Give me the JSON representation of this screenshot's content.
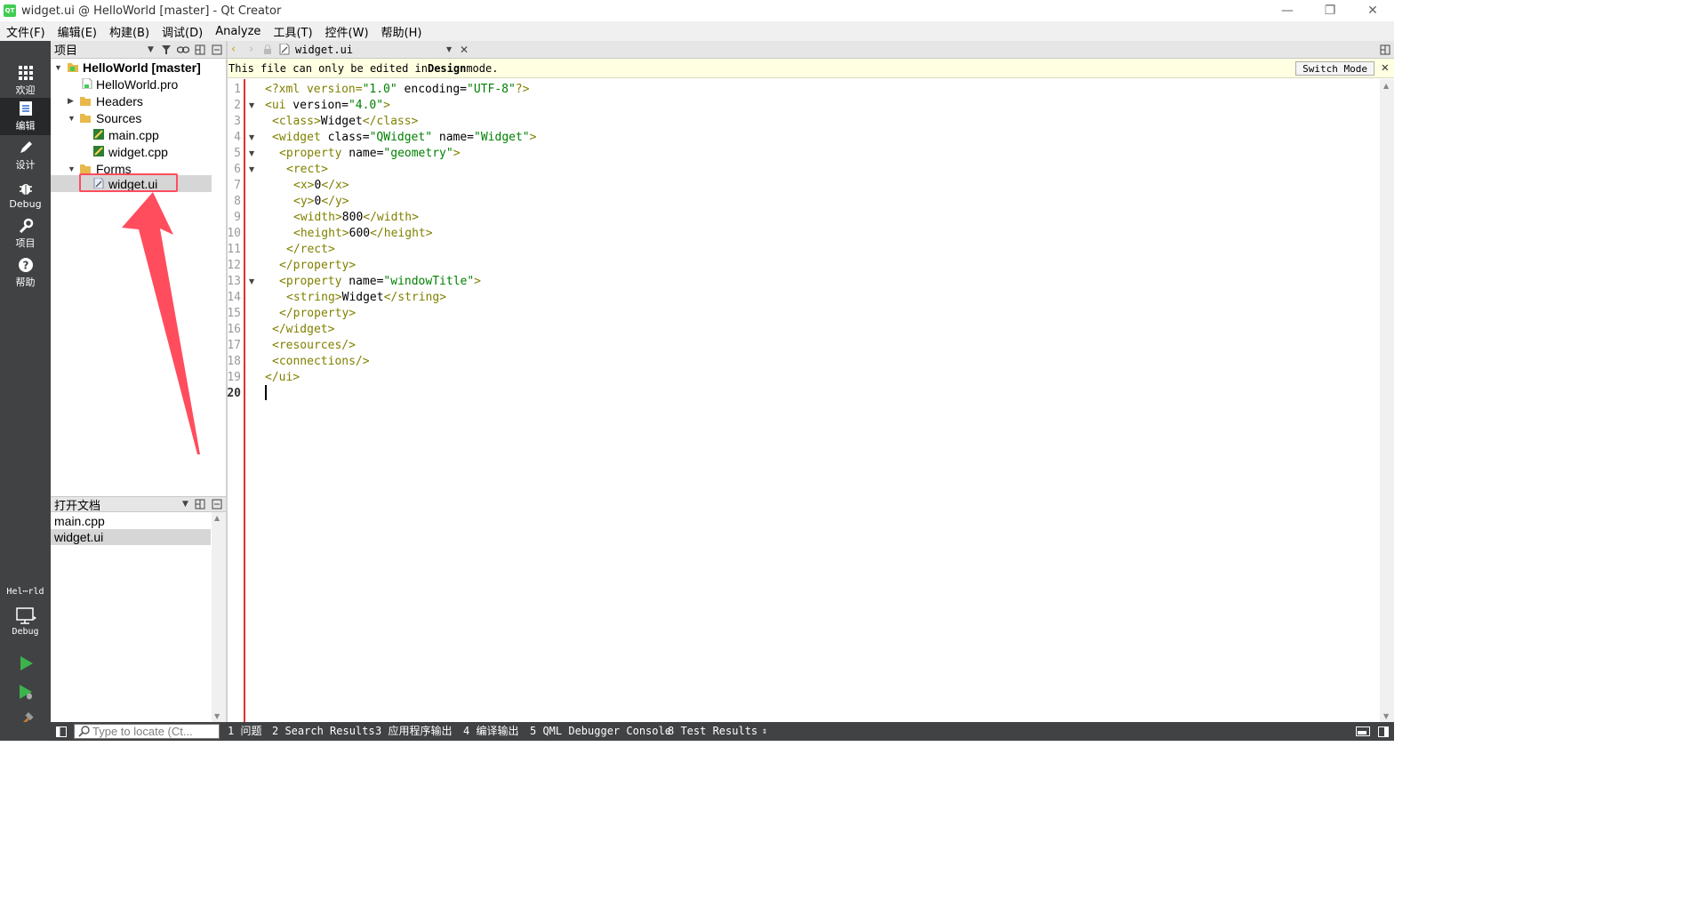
{
  "window": {
    "title": "widget.ui @ HelloWorld [master] - Qt Creator",
    "logo_text": "QT",
    "minimize": "—",
    "restore": "❐",
    "close": "✕"
  },
  "menu": [
    "文件(F)",
    "编辑(E)",
    "构建(B)",
    "调试(D)",
    "Analyze",
    "工具(T)",
    "控件(W)",
    "帮助(H)"
  ],
  "modes": [
    {
      "label": "欢迎",
      "icon": "grid-icon"
    },
    {
      "label": "编辑",
      "icon": "edit-doc-icon",
      "active": true
    },
    {
      "label": "设计",
      "icon": "pen-icon"
    },
    {
      "label": "Debug",
      "icon": "bug-icon"
    },
    {
      "label": "项目",
      "icon": "wrench-icon"
    },
    {
      "label": "帮助",
      "icon": "help-icon"
    }
  ],
  "kit": {
    "project": "Hel⋯rld",
    "config": "Debug"
  },
  "project_pane": {
    "title": "项目",
    "tree": [
      {
        "label": "HelloWorld [master]",
        "bold": true
      },
      {
        "label": "HelloWorld.pro"
      },
      {
        "label": "Headers"
      },
      {
        "label": "Sources"
      },
      {
        "label": "main.cpp"
      },
      {
        "label": "widget.cpp"
      },
      {
        "label": "Forms"
      },
      {
        "label": "widget.ui",
        "selected": true
      }
    ]
  },
  "open_docs": {
    "title": "打开文档",
    "items": [
      "main.cpp",
      "widget.ui"
    ]
  },
  "editor_toolbar": {
    "file": "widget.ui"
  },
  "infobar": {
    "prefix": "This file can only be edited in ",
    "bold": "Design",
    "suffix": " mode.",
    "button": "Switch Mode",
    "close": "✕"
  },
  "editor": {
    "current_line": 20,
    "lines": [
      "1",
      "2",
      "3",
      "4",
      "5",
      "6",
      "7",
      "8",
      "9",
      "10",
      "11",
      "12",
      "13",
      "14",
      "15",
      "16",
      "17",
      "18",
      "19",
      "20"
    ],
    "code": {
      "l1": {
        "a": "<?xml version=",
        "b": "\"1.0\"",
        "c": " encoding=",
        "d": "\"UTF-8\"",
        "e": "?>"
      },
      "l2": {
        "a": "<ui",
        "b": " version=",
        "c": "\"4.0\"",
        "d": ">"
      },
      "l3": {
        "a": "<class>",
        "b": "Widget",
        "c": "</class>"
      },
      "l4": {
        "a": "<widget",
        "b": " class=",
        "c": "\"QWidget\"",
        "d": " name=",
        "e": "\"Widget\"",
        "f": ">"
      },
      "l5": {
        "a": "<property",
        "b": " name=",
        "c": "\"geometry\"",
        "d": ">"
      },
      "l6": {
        "a": "<rect>"
      },
      "l7": {
        "a": "<x>",
        "b": "0",
        "c": "</x>"
      },
      "l8": {
        "a": "<y>",
        "b": "0",
        "c": "</y>"
      },
      "l9": {
        "a": "<width>",
        "b": "800",
        "c": "</width>"
      },
      "l10": {
        "a": "<height>",
        "b": "600",
        "c": "</height>"
      },
      "l11": {
        "a": "</rect>"
      },
      "l12": {
        "a": "</property>"
      },
      "l13": {
        "a": "<property",
        "b": " name=",
        "c": "\"windowTitle\"",
        "d": ">"
      },
      "l14": {
        "a": "<string>",
        "b": "Widget",
        "c": "</string>"
      },
      "l15": {
        "a": "</property>"
      },
      "l16": {
        "a": "</widget>"
      },
      "l17": {
        "a": "<resources/>"
      },
      "l18": {
        "a": "<connections/>"
      },
      "l19": {
        "a": "</ui>"
      }
    }
  },
  "statusbar": {
    "locator_placeholder": "Type to locate (Ct...",
    "panes": [
      "1 问题",
      "2 Search Results",
      "3 应用程序输出",
      "4 编译输出",
      "5 QML Debugger Console",
      "8 Test Results"
    ]
  },
  "colors": {
    "sidebar": "#404244",
    "active_mode": "#262829",
    "xml_tag": "#808000",
    "xml_value": "#008000",
    "annotation": "#ff4d5e",
    "run_green": "#3cb44b"
  }
}
